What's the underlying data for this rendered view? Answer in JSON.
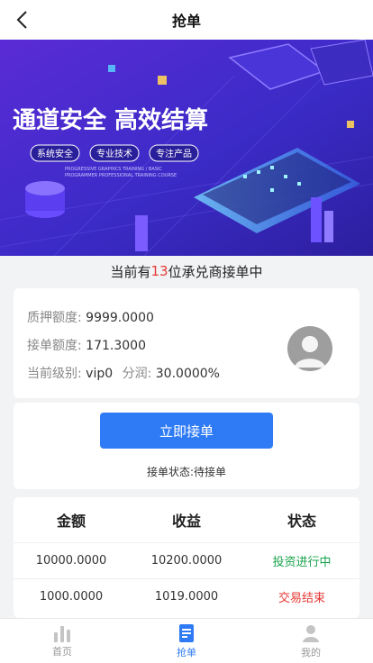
{
  "nav": {
    "title": "抢单"
  },
  "banner": {
    "headline": "通道安全 高效结算",
    "tags": [
      "系统安全",
      "专业技术",
      "专注产品"
    ],
    "subtext_1": "PROGRESSIVE GRAPHICS TRAINING / BASIC",
    "subtext_2": "PROGRAMMER PROFESSIONAL TRAINING COURSE"
  },
  "online": {
    "prefix": "当前有",
    "count": "13",
    "suffix": "位承兑商接单中"
  },
  "info": {
    "deposit_label": "质押额度:",
    "deposit_value": "9999.0000",
    "order_label": "接单额度:",
    "order_value": "171.3000",
    "level_label": "当前级别:",
    "level_value": "vip0",
    "share_label": "分润:",
    "share_value": "30.0000%"
  },
  "action": {
    "button_label": "立即接单",
    "status_text": "接单状态:待接单"
  },
  "table": {
    "headers": [
      "金额",
      "收益",
      "状态"
    ],
    "rows": [
      {
        "amount": "10000.0000",
        "profit": "10200.0000",
        "status": "投资进行中"
      },
      {
        "amount": "1000.0000",
        "profit": "1019.0000",
        "status": "交易结束"
      }
    ]
  },
  "tabbar": {
    "items": [
      {
        "label": "首页",
        "icon": "bar-chart-icon"
      },
      {
        "label": "抢单",
        "icon": "document-icon"
      },
      {
        "label": "我的",
        "icon": "user-icon"
      }
    ]
  },
  "colors": {
    "primary": "#2f7bf5",
    "danger": "#e53935",
    "success": "#16a34a"
  }
}
